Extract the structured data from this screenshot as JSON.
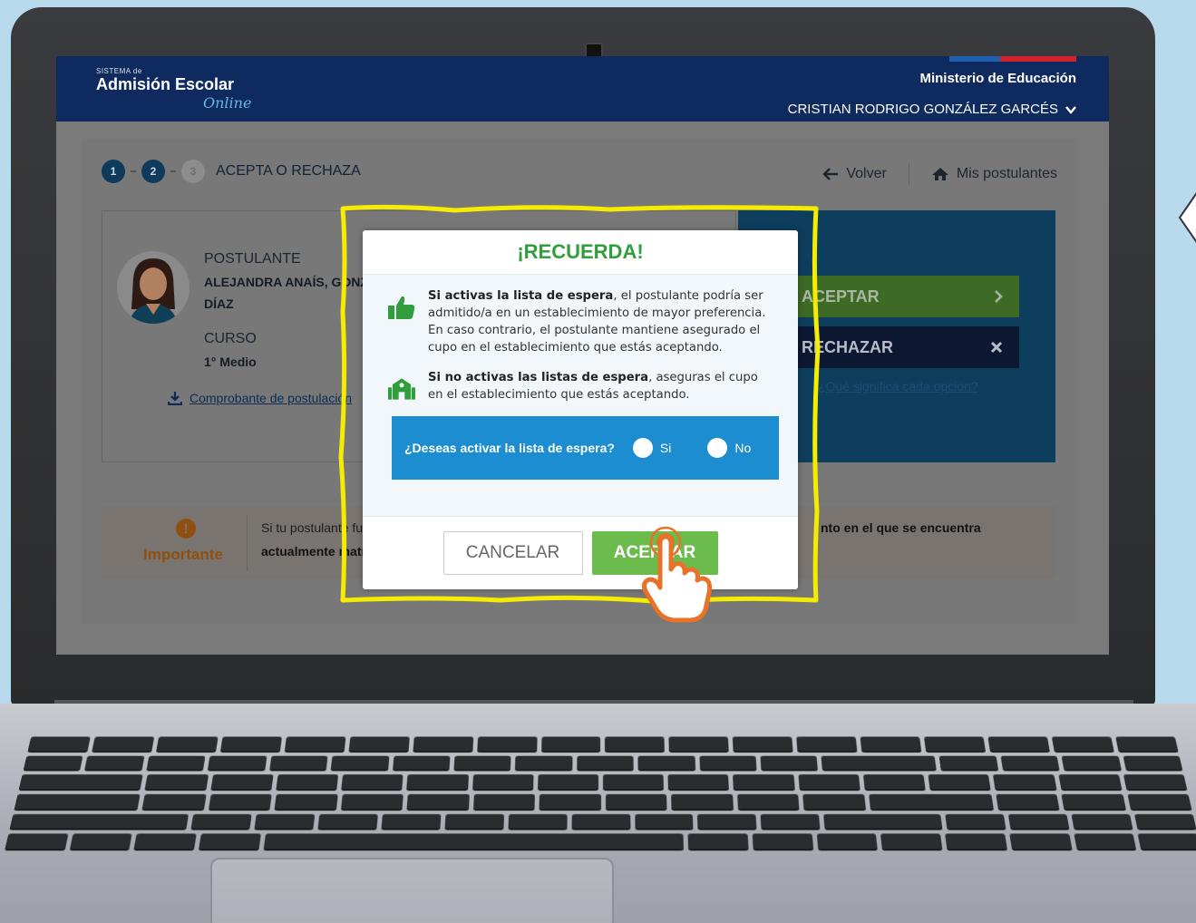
{
  "header": {
    "logo_small": "SISTEMA de",
    "logo_main": "Admisión Escolar",
    "logo_script": "Online",
    "ministry": "Ministerio de Educación",
    "user_name": "CRISTIAN RODRIGO GONZÁLEZ GARCÉS"
  },
  "steps": {
    "items": [
      "1",
      "2",
      "3"
    ],
    "current_label": "ACEPTA O RECHAZA"
  },
  "nav": {
    "back": "Volver",
    "my_applicants": "Mis postulantes"
  },
  "profile": {
    "applicant_label": "POSTULANTE",
    "applicant_name_line1": "ALEJANDRA ANAÍS, GONZ",
    "applicant_name_line2": "DÍAZ",
    "course_label": "CURSO",
    "course_value": "1° Medio",
    "receipt_link": "Comprobante de postulación"
  },
  "actions": {
    "accept": "ACEPTAR",
    "reject": "RECHAZAR",
    "what_means": "¿Qué significa cada opción?"
  },
  "important": {
    "title": "Importante",
    "text1": "Si tu postulante fu",
    "text2": "actualmente matr",
    "text3": "nto en el que se encuentra"
  },
  "modal": {
    "title": "¡RECUERDA!",
    "msg1_bold": "Si activas la lista de espera",
    "msg1_rest": ", el postulante podría ser admitido/a en un establecimiento de mayor preferencia. En caso contrario, el postulante mantiene asegurado el cupo en el establecimiento que estás aceptando.",
    "msg2_bold": "Si no activas las listas de espera",
    "msg2_rest": ", aseguras el cupo en el establecimiento que estás aceptando.",
    "question": "¿Deseas activar la lista de espera?",
    "option_yes": "Si",
    "option_no": "No",
    "cancel": "CANCELAR",
    "accept": "ACEPTAR"
  },
  "colors": {
    "header_bg": "#0f2a5e",
    "modal_title": "#2f9e3b",
    "question_bg": "#1b8dd0",
    "accept_btn": "#6cbb4d",
    "highlight": "#f5ec00",
    "hand": "#e8722a"
  }
}
